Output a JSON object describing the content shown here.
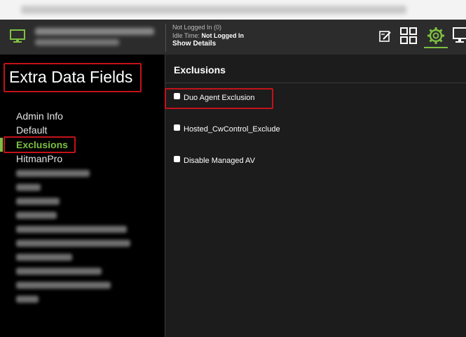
{
  "header": {
    "logged_in_label": "Not Logged In (0)",
    "idle_time_label": "Idle Time:",
    "idle_time_value": "Not Logged In",
    "show_details": "Show Details"
  },
  "sidebar": {
    "title": "Extra Data Fields",
    "items": [
      {
        "label": "Admin Info",
        "active": false
      },
      {
        "label": "Default",
        "active": false
      },
      {
        "label": "Exclusions",
        "active": true
      },
      {
        "label": "HitmanPro",
        "active": false
      }
    ]
  },
  "main": {
    "title": "Exclusions",
    "fields": [
      {
        "label": "Duo Agent Exclusion",
        "checked": false
      },
      {
        "label": "Hosted_CwControl_Exclude",
        "checked": false
      },
      {
        "label": "Disable Managed AV",
        "checked": false
      }
    ]
  },
  "colors": {
    "accent": "#7dc142",
    "highlight": "#c4121a",
    "background": "#1b1b1b"
  },
  "icons": [
    "monitor-icon",
    "edit-icon",
    "grid-icon",
    "gear-icon",
    "desktop-icon"
  ]
}
